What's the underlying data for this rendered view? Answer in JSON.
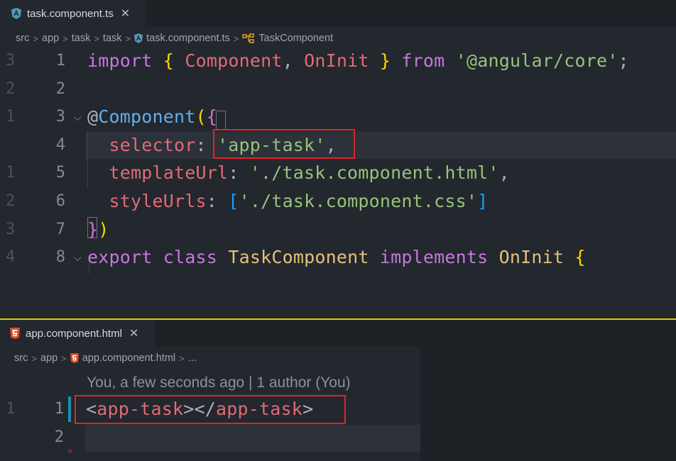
{
  "top_editor": {
    "tab": {
      "label": "task.component.ts",
      "close": "✕"
    },
    "breadcrumb": [
      "src",
      "app",
      "task",
      "task",
      "task.component.ts",
      "TaskComponent"
    ],
    "lines": [
      {
        "num": "1",
        "rel": "3",
        "tokens": [
          {
            "t": "import",
            "c": "kw"
          },
          {
            "t": " ",
            "c": "txt"
          },
          {
            "t": "{",
            "c": "br1"
          },
          {
            "t": " ",
            "c": "txt"
          },
          {
            "t": "Component",
            "c": "var"
          },
          {
            "t": ", ",
            "c": "txt"
          },
          {
            "t": "OnInit",
            "c": "var"
          },
          {
            "t": " ",
            "c": "txt"
          },
          {
            "t": "}",
            "c": "br1"
          },
          {
            "t": " ",
            "c": "txt"
          },
          {
            "t": "from",
            "c": "kw"
          },
          {
            "t": " ",
            "c": "txt"
          },
          {
            "t": "'@angular/core'",
            "c": "str"
          },
          {
            "t": ";",
            "c": "txt"
          }
        ]
      },
      {
        "num": "2",
        "rel": "2",
        "tokens": []
      },
      {
        "num": "3",
        "rel": "1",
        "fold": true,
        "tokens": [
          {
            "t": "@",
            "c": "txt"
          },
          {
            "t": "Component",
            "c": "fn"
          },
          {
            "t": "(",
            "c": "br1"
          },
          {
            "t": "{",
            "c": "br2"
          }
        ]
      },
      {
        "num": "4",
        "rel": "",
        "current": true,
        "tokens": [
          {
            "t": "  ",
            "c": "txt"
          },
          {
            "t": "selector",
            "c": "var"
          },
          {
            "t": ": ",
            "c": "txt"
          },
          {
            "t": "'app-task'",
            "c": "str"
          },
          {
            "t": ",",
            "c": "txt"
          }
        ]
      },
      {
        "num": "5",
        "rel": "1",
        "tokens": [
          {
            "t": "  ",
            "c": "txt"
          },
          {
            "t": "templateUrl",
            "c": "var"
          },
          {
            "t": ": ",
            "c": "txt"
          },
          {
            "t": "'./task.component.html'",
            "c": "str"
          },
          {
            "t": ",",
            "c": "txt"
          }
        ]
      },
      {
        "num": "6",
        "rel": "2",
        "tokens": [
          {
            "t": "  ",
            "c": "txt"
          },
          {
            "t": "styleUrls",
            "c": "var"
          },
          {
            "t": ": ",
            "c": "txt"
          },
          {
            "t": "[",
            "c": "br3"
          },
          {
            "t": "'./task.component.css'",
            "c": "str"
          },
          {
            "t": "]",
            "c": "br3"
          }
        ]
      },
      {
        "num": "7",
        "rel": "3",
        "tokens": [
          {
            "t": "}",
            "c": "br2"
          },
          {
            "t": ")",
            "c": "br1"
          }
        ]
      },
      {
        "num": "8",
        "rel": "4",
        "fold": true,
        "tokens": [
          {
            "t": "export",
            "c": "kw"
          },
          {
            "t": " ",
            "c": "txt"
          },
          {
            "t": "class",
            "c": "kw"
          },
          {
            "t": " ",
            "c": "txt"
          },
          {
            "t": "TaskComponent",
            "c": "cls"
          },
          {
            "t": " ",
            "c": "txt"
          },
          {
            "t": "implements",
            "c": "kw"
          },
          {
            "t": " ",
            "c": "txt"
          },
          {
            "t": "OnInit",
            "c": "cls"
          },
          {
            "t": " ",
            "c": "txt"
          },
          {
            "t": "{",
            "c": "br1"
          }
        ]
      }
    ]
  },
  "bottom_editor": {
    "tab": {
      "label": "app.component.html",
      "close": "✕"
    },
    "breadcrumb": [
      "src",
      "app",
      "app.component.html",
      "..."
    ],
    "blame": "You, a few seconds ago | 1 author (You)",
    "lines": [
      {
        "num": "1",
        "rel": "1",
        "tokens": [
          {
            "t": "<",
            "c": "txt"
          },
          {
            "t": "app-task",
            "c": "var"
          },
          {
            "t": "></",
            "c": "txt"
          },
          {
            "t": "app-task",
            "c": "var"
          },
          {
            "t": ">",
            "c": "txt"
          }
        ]
      },
      {
        "num": "2",
        "rel": "",
        "current": true,
        "tokens": []
      }
    ]
  },
  "colors": {
    "background": "#23272e",
    "divider": "#e5c700",
    "highlight_box": "#e0242b",
    "angular_icon": "#519aba",
    "html5_icon": "#e44d26"
  }
}
